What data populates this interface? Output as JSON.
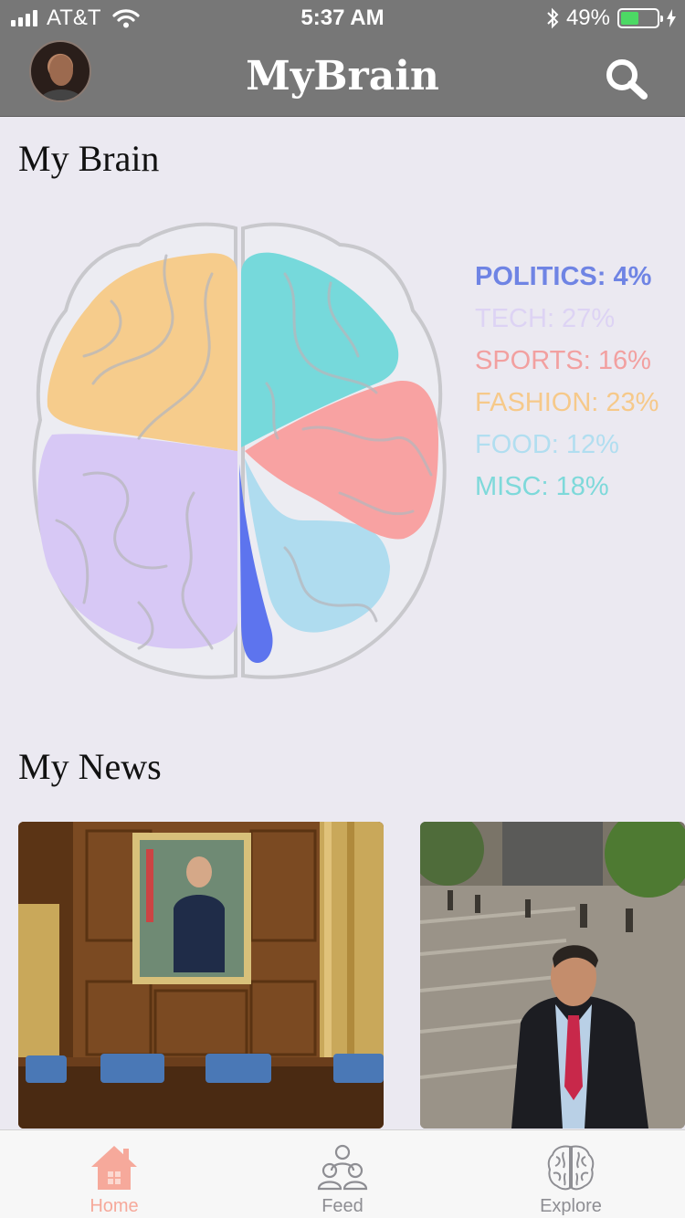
{
  "status": {
    "carrier": "AT&T",
    "time": "5:37 AM",
    "battery_percent": "49%",
    "battery_level": 0.49,
    "battery_color": "#4cd964"
  },
  "header": {
    "title": "MyBrain",
    "avatar_icon": "profile-avatar",
    "search_icon": "search-icon",
    "background": "#777777"
  },
  "brain_section": {
    "title": "My Brain",
    "legend": [
      {
        "text": "POLITICS: 4%",
        "color": "#6f84e4",
        "weight": "bold"
      },
      {
        "text": "TECH: 27%",
        "color": "#ddd3f4",
        "weight": "normal"
      },
      {
        "text": "SPORTS: 16%",
        "color": "#f2a0a0",
        "weight": "normal"
      },
      {
        "text": "FASHION: 23%",
        "color": "#f6c98a",
        "weight": "normal"
      },
      {
        "text": "FOOD: 12%",
        "color": "#b1def0",
        "weight": "normal"
      },
      {
        "text": "MISC: 18%",
        "color": "#7ed9da",
        "weight": "normal"
      }
    ],
    "region_colors": {
      "politics": "#5d74ee",
      "tech": "#d7c8f5",
      "sports": "#f8a2a2",
      "fashion": "#f6cc8c",
      "food": "#afdcef",
      "misc": "#76d9db"
    }
  },
  "news_section": {
    "title": "My News",
    "cards": [
      {
        "image": "portrait-in-wood-paneled-hearing-room"
      },
      {
        "image": "man-in-suit-on-campus-steps"
      }
    ]
  },
  "tabbar": {
    "active_color": "#f6a99b",
    "inactive_color": "#8e8e93",
    "tabs": [
      {
        "label": "Home",
        "icon": "home-icon",
        "active": true
      },
      {
        "label": "Feed",
        "icon": "people-icon",
        "active": false
      },
      {
        "label": "Explore",
        "icon": "brain-icon",
        "active": false
      }
    ]
  }
}
